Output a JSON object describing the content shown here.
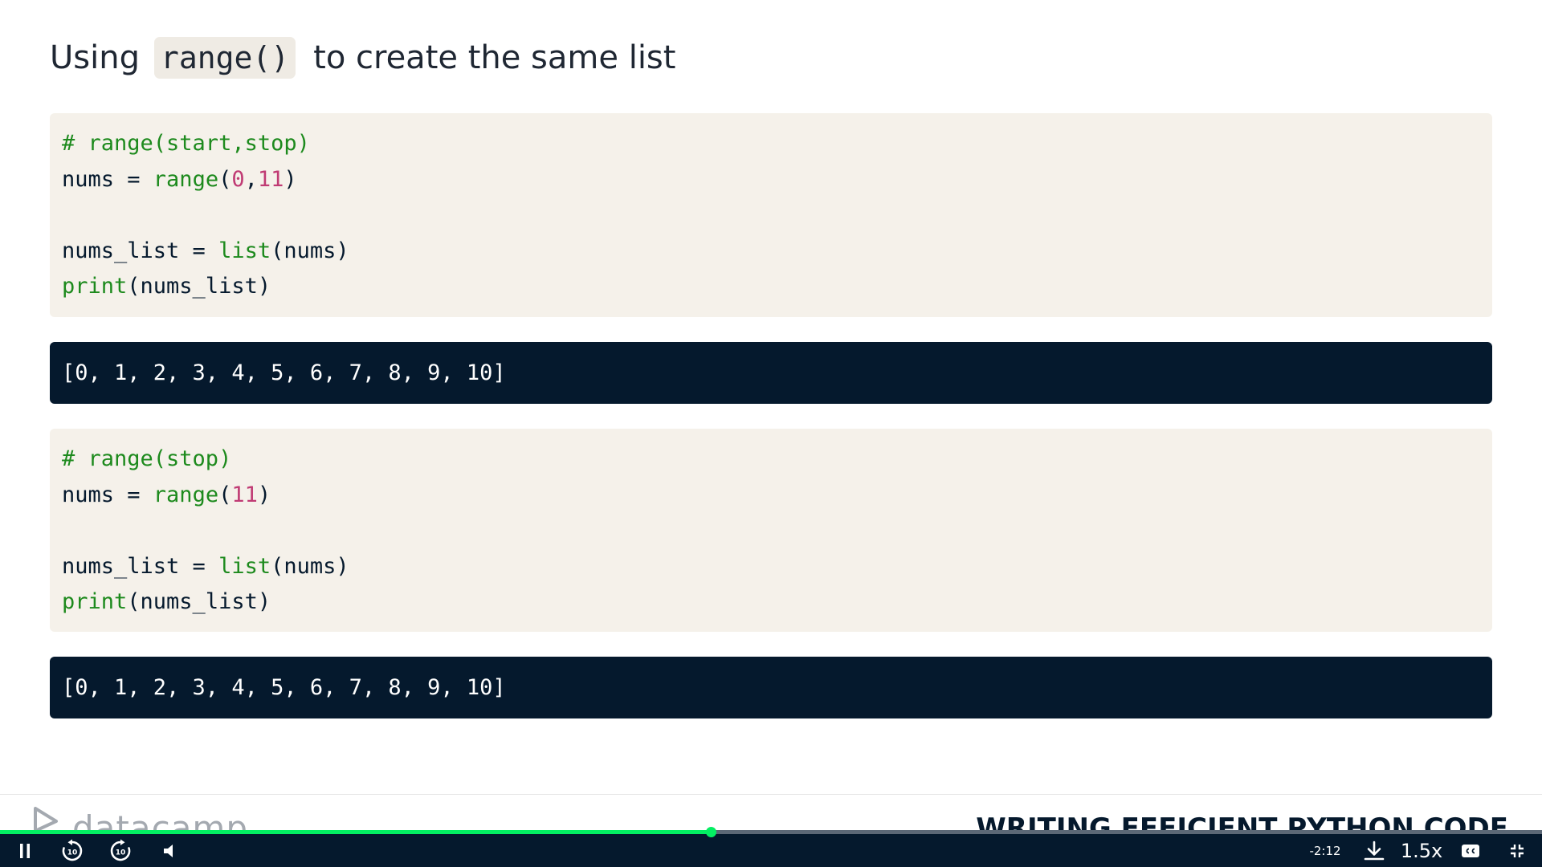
{
  "slide": {
    "title_prefix": "Using",
    "title_code": "range()",
    "title_suffix": "to create the same list"
  },
  "code_blocks": [
    {
      "lines": [
        [
          {
            "t": "# range(start,stop)",
            "c": "comment"
          }
        ],
        [
          {
            "t": "nums = ",
            "c": "plain"
          },
          {
            "t": "range",
            "c": "func"
          },
          {
            "t": "(",
            "c": "plain"
          },
          {
            "t": "0",
            "c": "num"
          },
          {
            "t": ",",
            "c": "plain"
          },
          {
            "t": "11",
            "c": "num"
          },
          {
            "t": ")",
            "c": "plain"
          }
        ],
        [
          {
            "t": "",
            "c": "plain"
          }
        ],
        [
          {
            "t": "nums_list = ",
            "c": "plain"
          },
          {
            "t": "list",
            "c": "func"
          },
          {
            "t": "(nums)",
            "c": "plain"
          }
        ],
        [
          {
            "t": "print",
            "c": "func"
          },
          {
            "t": "(nums_list)",
            "c": "plain"
          }
        ]
      ],
      "output": "[0, 1, 2, 3, 4, 5, 6, 7, 8, 9, 10]"
    },
    {
      "lines": [
        [
          {
            "t": "# range(stop)",
            "c": "comment"
          }
        ],
        [
          {
            "t": "nums = ",
            "c": "plain"
          },
          {
            "t": "range",
            "c": "func"
          },
          {
            "t": "(",
            "c": "plain"
          },
          {
            "t": "11",
            "c": "num"
          },
          {
            "t": ")",
            "c": "plain"
          }
        ],
        [
          {
            "t": "",
            "c": "plain"
          }
        ],
        [
          {
            "t": "nums_list = ",
            "c": "plain"
          },
          {
            "t": "list",
            "c": "func"
          },
          {
            "t": "(nums)",
            "c": "plain"
          }
        ],
        [
          {
            "t": "print",
            "c": "func"
          },
          {
            "t": "(nums_list)",
            "c": "plain"
          }
        ]
      ],
      "output": "[0, 1, 2, 3, 4, 5, 6, 7, 8, 9, 10]"
    }
  ],
  "footer": {
    "brand": "datacamp",
    "course_title": "WRITING EFFICIENT PYTHON CODE"
  },
  "player": {
    "progress_fraction": 0.461,
    "time_remaining": "-2:12",
    "speed": "1.5x",
    "rewind_label": "10",
    "forward_label": "10",
    "icons": {
      "pause": "pause-icon",
      "rewind": "rewind-10-icon",
      "forward": "forward-10-icon",
      "volume": "volume-icon",
      "download": "download-icon",
      "captions": "captions-icon",
      "exit_fullscreen": "exit-fullscreen-icon"
    },
    "colors": {
      "accent": "#03ef62",
      "bar": "#05192d"
    }
  },
  "colors": {
    "code_bg": "#f5f1ea",
    "output_bg": "#05192d",
    "comment": "#1d8a1d",
    "number": "#c03b74"
  }
}
